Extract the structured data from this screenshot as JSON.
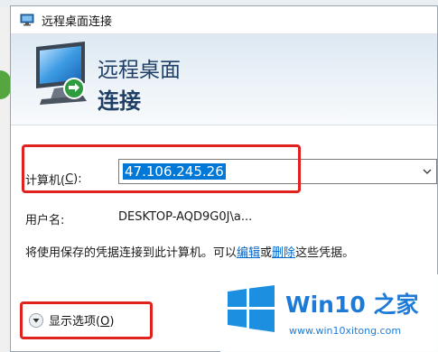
{
  "window": {
    "title": "远程桌面连接"
  },
  "banner": {
    "line1": "远程桌面",
    "line2": "连接"
  },
  "form": {
    "computer_label": "计算机(",
    "computer_label_key": "C",
    "computer_label_end": "):",
    "computer_value": "47.106.245.26",
    "username_label": "用户名:",
    "username_value": "DESKTOP-AQD9G0J\\a..."
  },
  "info": {
    "text_before": "将使用保存的凭据连接到此计算机。可以",
    "edit_link": "编辑",
    "text_or": "或",
    "delete_link": "删除",
    "text_after": "这些凭据。"
  },
  "options": {
    "label": "显示选项(",
    "key": "O",
    "label_end": ")"
  },
  "watermark": {
    "title_a": "Win10",
    "title_b": " 之家",
    "sub": "www.win10xitong.com"
  },
  "colors": {
    "highlight": "#e0221f",
    "selection": "#0078d7",
    "link": "#0066cc",
    "watermark_blue": "#1d7bd8"
  }
}
